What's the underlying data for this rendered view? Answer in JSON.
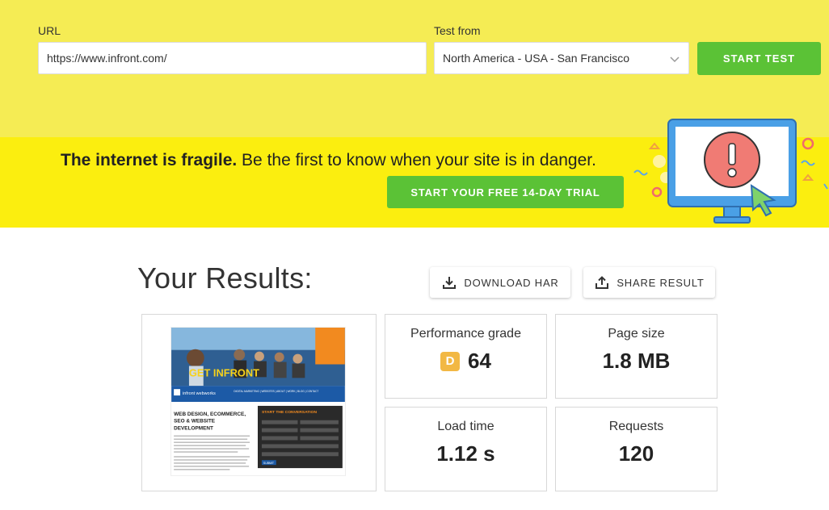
{
  "form": {
    "url_label": "URL",
    "url_value": "https://www.infront.com/",
    "test_from_label": "Test from",
    "test_from_value": "North America - USA - San Francisco",
    "start_button": "START TEST"
  },
  "banner": {
    "tagline_bold": "The internet is fragile.",
    "tagline_rest": " Be the first to know when your site is in danger.",
    "trial_button": "START YOUR FREE 14-DAY TRIAL"
  },
  "results": {
    "title": "Your Results:",
    "download_button": "DOWNLOAD HAR",
    "share_button": "SHARE RESULT",
    "performance": {
      "label": "Performance grade",
      "grade": "D",
      "value": "64"
    },
    "page_size": {
      "label": "Page size",
      "value": "1.8 MB"
    },
    "load_time": {
      "label": "Load time",
      "value": "1.12 s"
    },
    "requests": {
      "label": "Requests",
      "value": "120"
    }
  },
  "thumbnail": {
    "hero_title": "GET INFRONT",
    "logo": "infront webworks",
    "nav": "DIGITAL MARKETING | WEBSITES | ABOUT | WORK | BLOG | CONTACT",
    "headline": "WEB DESIGN, ECOMMERCE, SEO & WEBSITE DEVELOPMENT",
    "form_title": "START THE CONVERSATION",
    "submit": "SUBMIT"
  },
  "colors": {
    "top_bg": "#f5ec54",
    "banner_bg": "#fbee0f",
    "green": "#5bc236",
    "grade_d": "#f2b844"
  },
  "icons": [
    "chevron-down-icon",
    "download-icon",
    "share-icon",
    "monitor-alert-icon"
  ]
}
